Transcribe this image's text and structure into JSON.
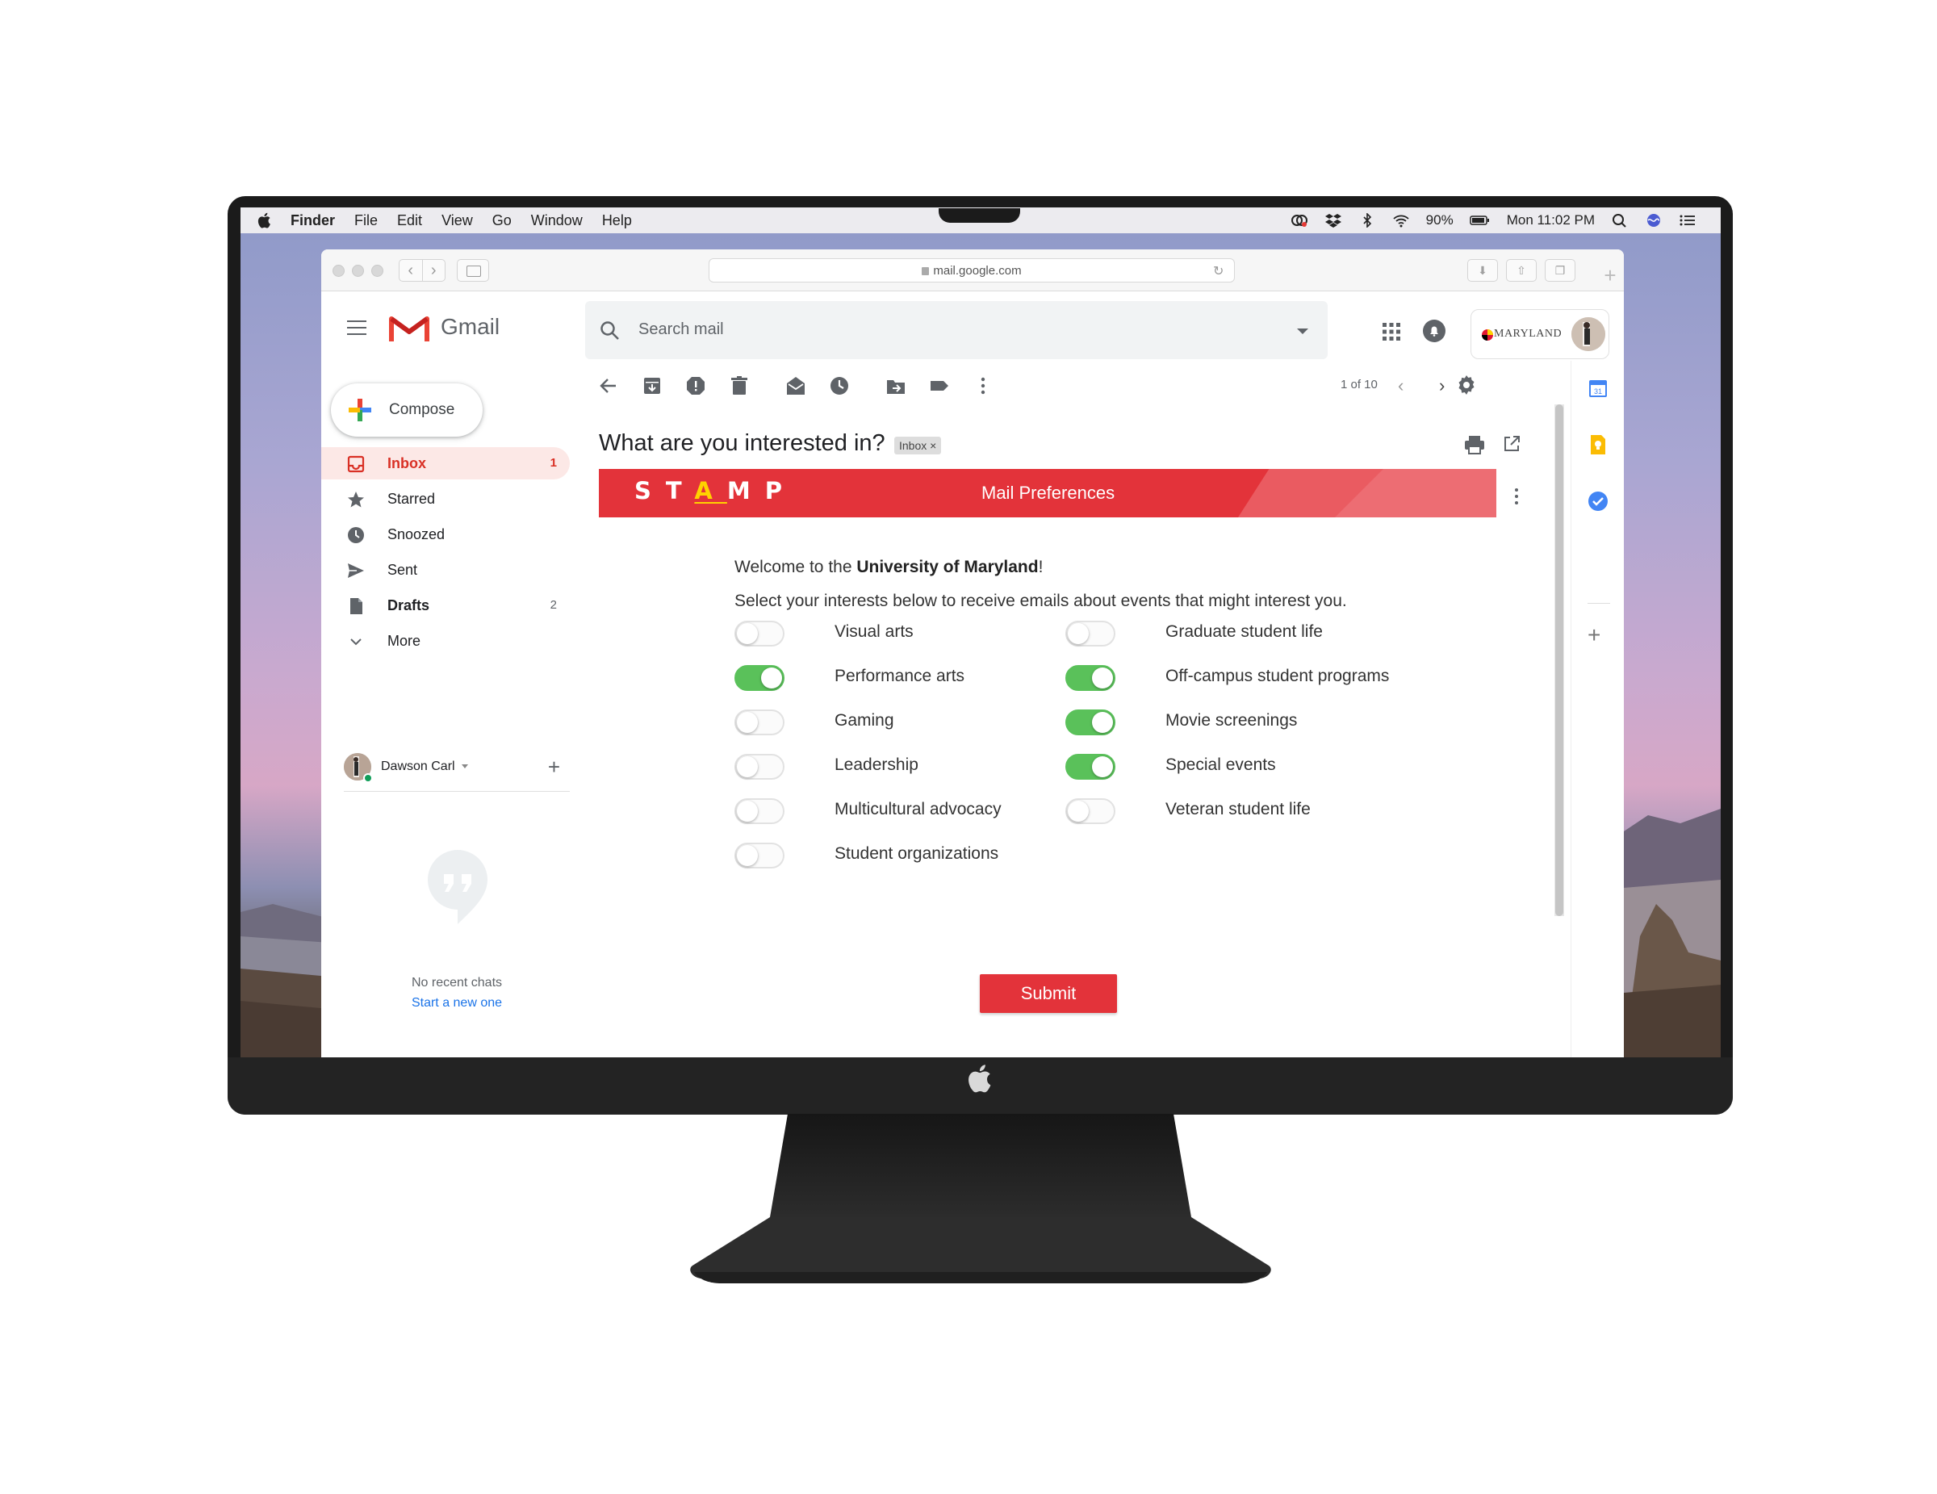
{
  "menubar": {
    "app": "Finder",
    "items": [
      "File",
      "Edit",
      "View",
      "Go",
      "Window",
      "Help"
    ],
    "battery": "90%",
    "clock": "Mon 11:02 PM"
  },
  "browser": {
    "url": "mail.google.com"
  },
  "gmail": {
    "app_name": "Gmail",
    "search_placeholder": "Search mail",
    "compose_label": "Compose",
    "nav": [
      {
        "label": "Inbox",
        "count": "1"
      },
      {
        "label": "Starred",
        "count": ""
      },
      {
        "label": "Snoozed",
        "count": ""
      },
      {
        "label": "Sent",
        "count": ""
      },
      {
        "label": "Drafts",
        "count": "2"
      },
      {
        "label": "More",
        "count": ""
      }
    ],
    "hangouts_user": "Dawson Carl",
    "no_chats": "No recent chats",
    "start_new": "Start a new one",
    "pager": "1 of 10",
    "account_org": "MARYLAND"
  },
  "email": {
    "subject": "What are you interested in?",
    "label_chip": "Inbox ×",
    "banner_logo": [
      "S",
      "T",
      "A",
      "M",
      "P"
    ],
    "banner_title": "Mail Preferences",
    "welcome_prefix": "Welcome to the ",
    "welcome_org": "University of Maryland",
    "welcome_suffix": "!",
    "instructions": "Select your interests below to receive emails about events that might interest you.",
    "preferences_left": [
      {
        "label": "Visual arts",
        "on": false
      },
      {
        "label": "Performance arts",
        "on": true
      },
      {
        "label": "Gaming",
        "on": false
      },
      {
        "label": "Leadership",
        "on": false
      },
      {
        "label": "Multicultural advocacy",
        "on": false
      },
      {
        "label": "Student organizations",
        "on": false
      }
    ],
    "preferences_right": [
      {
        "label": "Graduate student life",
        "on": false
      },
      {
        "label": "Off-campus student programs",
        "on": true
      },
      {
        "label": "Movie screenings",
        "on": true
      },
      {
        "label": "Special events",
        "on": true
      },
      {
        "label": "Veteran student life",
        "on": false
      }
    ],
    "submit_label": "Submit"
  },
  "colors": {
    "accent_red": "#e3333a",
    "toggle_on": "#5ac15a",
    "gmail_red": "#d93025",
    "link_blue": "#1a73e8"
  }
}
